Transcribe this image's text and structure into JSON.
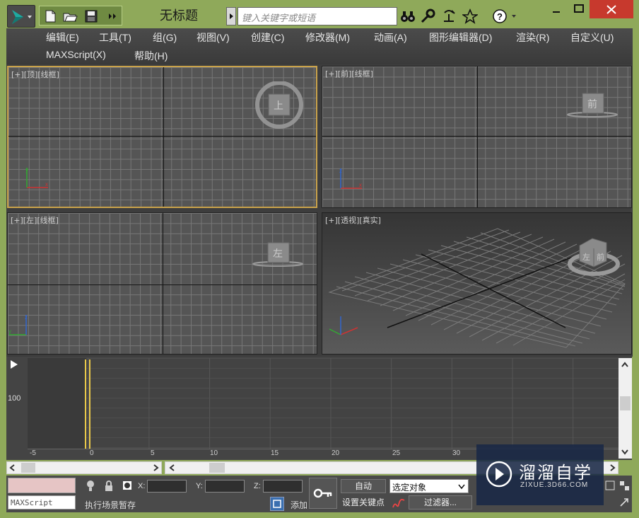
{
  "title": "无标题",
  "search": {
    "placeholder": "键入关键字或短语"
  },
  "menu": [
    "编辑(E)",
    "工具(T)",
    "组(G)",
    "视图(V)",
    "创建(C)",
    "修改器(M)",
    "动画(A)",
    "图形编辑器(D)",
    "渲染(R)",
    "自定义(U)",
    "MAXScript(X)",
    "帮助(H)"
  ],
  "viewports": {
    "top": {
      "label": "[+][顶][线框]",
      "cube": "上"
    },
    "front": {
      "label": "[+][前][线框]",
      "cube": "前"
    },
    "left": {
      "label": "[+][左][线框]",
      "cube": "左"
    },
    "persp": {
      "label": "[+][透视][真实]",
      "cube_front": "前",
      "cube_left": "左"
    }
  },
  "timeline": {
    "value_label": "100",
    "ticks": [
      "-5",
      "0",
      "5",
      "10",
      "15",
      "20",
      "25",
      "30"
    ],
    "current_frame": 0
  },
  "status": {
    "script_label": "MAXScript",
    "message": "执行场景暂存",
    "x_label": "X:",
    "y_label": "Y:",
    "z_label": "Z:",
    "add_label": "添加",
    "auto_label": "自动",
    "set_key_label": "设置关键点",
    "select_dropdown": "选定对象",
    "filter_label": "过滤器..."
  },
  "watermark": {
    "brand": "溜溜自学",
    "url": "ZIXUE.3D66.COM"
  },
  "colors": {
    "accent_frame": "#8fa95a",
    "viewport_active": "#c9a24a",
    "time_slider": "#e8c84a"
  }
}
